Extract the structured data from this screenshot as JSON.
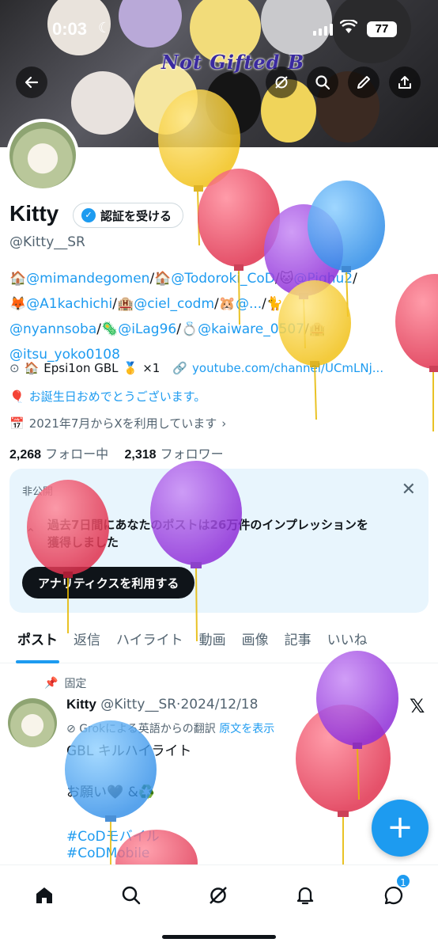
{
  "status_bar": {
    "time": "0:03",
    "battery": "77"
  },
  "banner": {
    "text": "Not Gifted  B"
  },
  "profile": {
    "name": "Kitty",
    "verify_label": "認証を受ける",
    "handle": "@Kitty__SR",
    "bio": {
      "m1": "@mimandegomen",
      "m2": "@Todoroki_CoD",
      "m3": "@Piqhu2",
      "m4": "@A1kachichi",
      "m5": "@ciel_codm",
      "m6": "@...",
      "m7": "@nyannsoba",
      "m8": "@iLag96",
      "m9": "@kaiware_0507",
      "m10": "@itsu_yoko0108"
    },
    "location": "Epsi1on GBL",
    "location_suffix": "×1",
    "website": "youtube.com/channel/UCmLNj...",
    "birthday": "お誕生日おめでとうございます。",
    "joined": "2021年7月からXを利用しています",
    "following_count": "2,268",
    "following_label": "フォロー中",
    "followers_count": "2,318",
    "followers_label": "フォロワー"
  },
  "analytics_card": {
    "private_label": "非公開",
    "message_line1": "過去7日間にあなたのポストは26万件のインプレッションを",
    "message_line2": "獲得しました",
    "cta": "アナリティクスを利用する"
  },
  "tabs": [
    "ポスト",
    "返信",
    "ハイライト",
    "動画",
    "画像",
    "記事",
    "いいね"
  ],
  "post": {
    "pinned_label": "固定",
    "author": "Kitty",
    "handle_date": "@Kitty__SR·2024/12/18",
    "translate_label": "Grokによる英語からの翻訳",
    "show_original": "原文を表示",
    "body": "GBL キルハイライト\n\nお願い🖤 &♻️",
    "hashtag1": "#CoDモバイル",
    "hashtag2": "#CoDMobile"
  },
  "bottom_nav": {
    "messages_badge": "1"
  },
  "colors": {
    "accent": "#1d9bf0",
    "text": "#0f1419",
    "muted": "#536471",
    "card_bg": "#e8f5fd"
  }
}
